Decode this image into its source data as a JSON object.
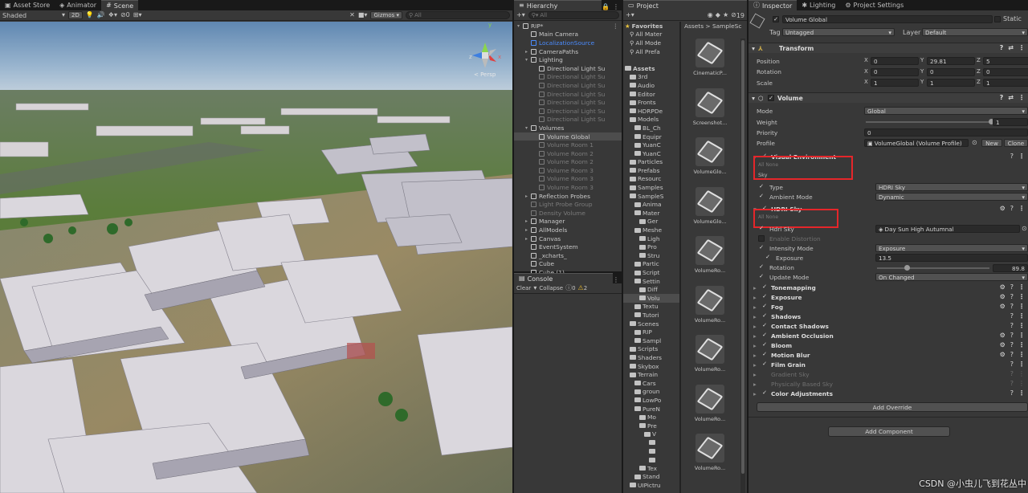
{
  "scene": {
    "tabs": [
      "Asset Store",
      "Animator",
      "Scene"
    ],
    "shading": "Shaded",
    "mode_2d": "2D",
    "gizmos": "Gizmos",
    "search_placeholder": "All",
    "persp_label": "< Persp",
    "gizmo_axes": {
      "x": "x",
      "y": "y",
      "z": "z"
    }
  },
  "hierarchy": {
    "tab": "Hierarchy",
    "search_placeholder": "All",
    "items": [
      {
        "label": "RIP*",
        "depth": 0,
        "type": "scene"
      },
      {
        "label": "Main Camera",
        "depth": 1
      },
      {
        "label": "LocalizationSource",
        "depth": 1,
        "blue": true
      },
      {
        "label": "CameraPaths",
        "depth": 1,
        "arrow": "right"
      },
      {
        "label": "Lighting",
        "depth": 1,
        "arrow": "down"
      },
      {
        "label": "Directional Light Su",
        "depth": 2
      },
      {
        "label": "Directional Light Su",
        "depth": 2,
        "dim": true
      },
      {
        "label": "Directional Light Su",
        "depth": 2,
        "dim": true
      },
      {
        "label": "Directional Light Su",
        "depth": 2,
        "dim": true
      },
      {
        "label": "Directional Light Su",
        "depth": 2,
        "dim": true
      },
      {
        "label": "Directional Light Su",
        "depth": 2,
        "dim": true
      },
      {
        "label": "Directional Light Su",
        "depth": 2,
        "dim": true
      },
      {
        "label": "Volumes",
        "depth": 1,
        "arrow": "down"
      },
      {
        "label": "Volume Global",
        "depth": 2,
        "sel": true
      },
      {
        "label": "Volume Room 1",
        "depth": 2,
        "dim": true
      },
      {
        "label": "Volume Room 2",
        "depth": 2,
        "dim": true
      },
      {
        "label": "Volume Room 2",
        "depth": 2,
        "dim": true
      },
      {
        "label": "Volume Room 3",
        "depth": 2,
        "dim": true
      },
      {
        "label": "Volume Room 3",
        "depth": 2,
        "dim": true
      },
      {
        "label": "Volume Room 3",
        "depth": 2,
        "dim": true
      },
      {
        "label": "Reflection Probes",
        "depth": 1,
        "arrow": "right"
      },
      {
        "label": "Light Probe Group",
        "depth": 1,
        "dim": true
      },
      {
        "label": "Density Volume",
        "depth": 1,
        "dim": true
      },
      {
        "label": "Manager",
        "depth": 1,
        "arrow": "right"
      },
      {
        "label": "AllModels",
        "depth": 1,
        "arrow": "right"
      },
      {
        "label": "Canvas",
        "depth": 1,
        "arrow": "right"
      },
      {
        "label": "EventSystem",
        "depth": 1
      },
      {
        "label": "_xcharts_",
        "depth": 1
      },
      {
        "label": "Cube",
        "depth": 1
      },
      {
        "label": "Cube (1)",
        "depth": 1
      }
    ]
  },
  "console": {
    "tab": "Console",
    "clear": "Clear",
    "collapse": "Collapse",
    "info_count": "0",
    "warn_count": "2"
  },
  "project": {
    "tab": "Project",
    "count": "19",
    "breadcrumb": "Assets > SampleSc",
    "tree": [
      {
        "label": "Favorites",
        "depth": 0,
        "star": true
      },
      {
        "label": "All Mater",
        "depth": 1,
        "search": true
      },
      {
        "label": "All Mode",
        "depth": 1,
        "search": true
      },
      {
        "label": "All Prefa",
        "depth": 1,
        "search": true
      },
      {
        "label": "",
        "depth": 0
      },
      {
        "label": "Assets",
        "depth": 0
      },
      {
        "label": "3rd",
        "depth": 1
      },
      {
        "label": "Audio",
        "depth": 1
      },
      {
        "label": "Editor",
        "depth": 1
      },
      {
        "label": "Fronts",
        "depth": 1
      },
      {
        "label": "HDRPDe",
        "depth": 1
      },
      {
        "label": "Models",
        "depth": 1
      },
      {
        "label": "BL_Ch",
        "depth": 2
      },
      {
        "label": "Equipr",
        "depth": 2
      },
      {
        "label": "YuanC",
        "depth": 2
      },
      {
        "label": "YuanC",
        "depth": 2
      },
      {
        "label": "Particles",
        "depth": 1
      },
      {
        "label": "Prefabs",
        "depth": 1
      },
      {
        "label": "Resourc",
        "depth": 1
      },
      {
        "label": "Samples",
        "depth": 1
      },
      {
        "label": "SampleS",
        "depth": 1
      },
      {
        "label": "Anima",
        "depth": 2
      },
      {
        "label": "Mater",
        "depth": 2
      },
      {
        "label": "Ger",
        "depth": 3
      },
      {
        "label": "Meshe",
        "depth": 2
      },
      {
        "label": "Ligh",
        "depth": 3
      },
      {
        "label": "Pro",
        "depth": 3
      },
      {
        "label": "Stru",
        "depth": 3
      },
      {
        "label": "Partic",
        "depth": 2
      },
      {
        "label": "Script",
        "depth": 2
      },
      {
        "label": "Settin",
        "depth": 2
      },
      {
        "label": "Diff",
        "depth": 3
      },
      {
        "label": "Volu",
        "depth": 3,
        "sel": true
      },
      {
        "label": "Textu",
        "depth": 2
      },
      {
        "label": "Tutori",
        "depth": 2
      },
      {
        "label": "Scenes",
        "depth": 1
      },
      {
        "label": "RIP",
        "depth": 2
      },
      {
        "label": "Sampl",
        "depth": 2
      },
      {
        "label": "Scripts",
        "depth": 1
      },
      {
        "label": "Shaders",
        "depth": 1
      },
      {
        "label": "Skybox",
        "depth": 1
      },
      {
        "label": "Terrain",
        "depth": 1
      },
      {
        "label": "Cars",
        "depth": 2
      },
      {
        "label": "groun",
        "depth": 2
      },
      {
        "label": "LowPo",
        "depth": 2
      },
      {
        "label": "PureN",
        "depth": 2
      },
      {
        "label": "Mo",
        "depth": 3
      },
      {
        "label": "Pre",
        "depth": 3
      },
      {
        "label": "V",
        "depth": 4
      },
      {
        "label": "",
        "depth": 5
      },
      {
        "label": "",
        "depth": 5
      },
      {
        "label": "",
        "depth": 5
      },
      {
        "label": "Tex",
        "depth": 3
      },
      {
        "label": "Stand",
        "depth": 2
      },
      {
        "label": "UIPictru",
        "depth": 1
      }
    ],
    "assets": [
      "CinematicP...",
      "Screenshot...",
      "VolumeGlo...",
      "VolumeGlo...",
      "VolumeRo...",
      "VolumeRo...",
      "VolumeRo...",
      "VolumeRo...",
      "VolumeRo..."
    ]
  },
  "inspector": {
    "tabs": [
      "Inspector",
      "Lighting",
      "Project Settings"
    ],
    "object_name": "Volume Global",
    "static_label": "Static",
    "tag_label": "Tag",
    "tag_value": "Untagged",
    "layer_label": "Layer",
    "layer_value": "Default",
    "transform": {
      "title": "Transform",
      "rows": [
        {
          "label": "Position",
          "x": "0",
          "y": "29.81",
          "z": "5"
        },
        {
          "label": "Rotation",
          "x": "0",
          "y": "0",
          "z": "0"
        },
        {
          "label": "Scale",
          "x": "1",
          "y": "1",
          "z": "1"
        }
      ]
    },
    "volume": {
      "title": "Volume",
      "mode_label": "Mode",
      "mode_value": "Global",
      "weight_label": "Weight",
      "weight_value": "1",
      "priority_label": "Priority",
      "priority_value": "0",
      "profile_label": "Profile",
      "profile_value": "VolumeGlobal (Volume Profile)",
      "new_btn": "New",
      "clone_btn": "Clone"
    },
    "visual_env": {
      "title": "Visual Environment",
      "all": "All",
      "none": "None",
      "sky_label": "Sky",
      "type_label": "Type",
      "type_value": "HDRI Sky",
      "ambient_label": "Ambient Mode",
      "ambient_value": "Dynamic"
    },
    "hdri": {
      "title": "HDRI Sky",
      "all": "All",
      "none": "None",
      "sky_label": "Hdri Sky",
      "sky_value": "Day Sun High Autumnal",
      "distortion_label": "Enable Distortion",
      "intensity_label": "Intensity Mode",
      "intensity_value": "Exposure",
      "exposure_label": "Exposure",
      "exposure_value": "13.5",
      "rotation_label": "Rotation",
      "rotation_value": "89.8",
      "update_label": "Update Mode",
      "update_value": "On Changed"
    },
    "overrides": [
      {
        "label": "Tonemapping",
        "active": true,
        "preset": true
      },
      {
        "label": "Exposure",
        "active": true,
        "preset": true
      },
      {
        "label": "Fog",
        "active": true,
        "preset": true
      },
      {
        "label": "Shadows",
        "active": true,
        "preset": false
      },
      {
        "label": "Contact Shadows",
        "active": true,
        "preset": false
      },
      {
        "label": "Ambient Occlusion",
        "active": true,
        "preset": true
      },
      {
        "label": "Bloom",
        "active": true,
        "preset": true
      },
      {
        "label": "Motion Blur",
        "active": true,
        "preset": true
      },
      {
        "label": "Film Grain",
        "active": true,
        "preset": false
      },
      {
        "label": "Gradient Sky",
        "active": false,
        "preset": false
      },
      {
        "label": "Physically Based Sky",
        "active": false,
        "preset": false
      },
      {
        "label": "Color Adjustments",
        "active": true,
        "preset": false
      }
    ],
    "add_override": "Add Override",
    "add_component": "Add Component"
  },
  "watermark": "CSDN @小虫儿飞到花丛中"
}
